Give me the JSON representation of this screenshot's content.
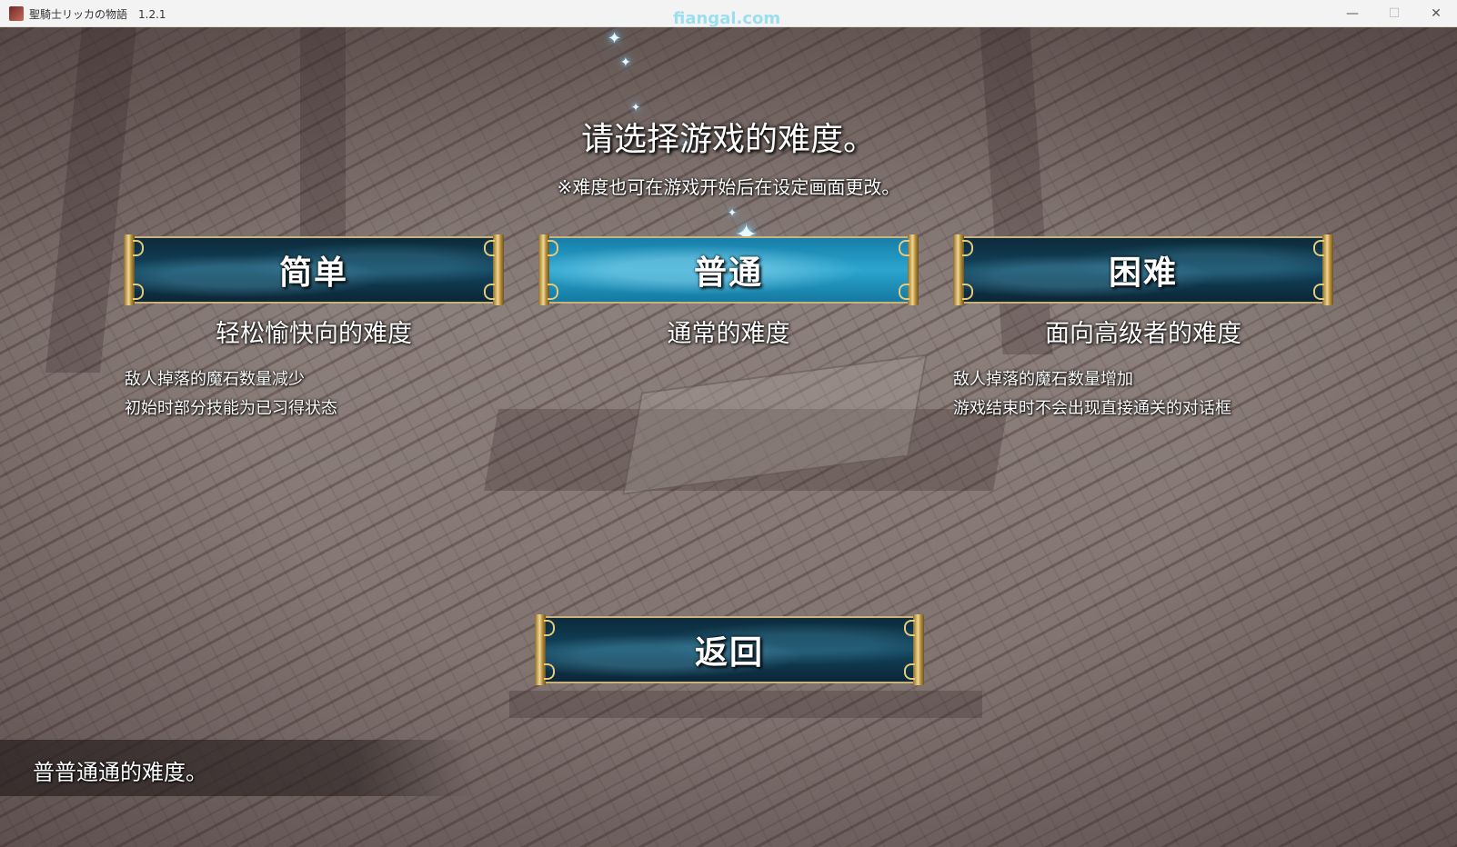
{
  "window": {
    "title": "聖騎士リッカの物語　1.2.1",
    "watermark": "fiangal.com",
    "minimize_symbol": "—",
    "maximize_symbol": "☐",
    "close_symbol": "✕"
  },
  "screen": {
    "heading": "请选择游戏的难度。",
    "subheading": "※难度也可在游戏开始后在设定画面更改。"
  },
  "difficulties": [
    {
      "label": "简单",
      "subtitle": "轻松愉快向的难度",
      "details": [
        "敌人掉落的魔石数量减少",
        "初始时部分技能为已习得状态"
      ],
      "selected": false
    },
    {
      "label": "普通",
      "subtitle": "通常的难度",
      "details": [],
      "selected": true
    },
    {
      "label": "困难",
      "subtitle": "面向高级者的难度",
      "details": [
        "敌人掉落的魔石数量增加",
        "游戏结束时不会出现直接通关的对话框"
      ],
      "selected": false
    }
  ],
  "back_button": {
    "label": "返回"
  },
  "help": {
    "text": "普普通通的难度。"
  },
  "colors": {
    "button_dark": "#12455e",
    "button_selected": "#2aa5cf",
    "gold_frame": "#cbb27a",
    "sparkle": "#8fdcff"
  },
  "icons": {
    "app": "app-icon",
    "sparkle": "sparkle-icon"
  }
}
